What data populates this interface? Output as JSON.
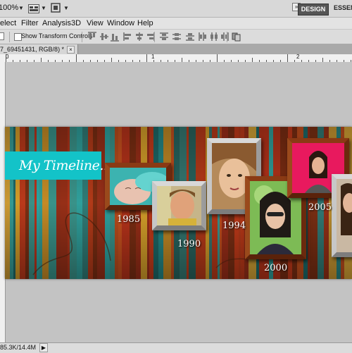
{
  "appbar": {
    "zoom": "100%",
    "workspace_active": "DESIGN",
    "workspace_next": "ESSEN"
  },
  "menu": {
    "items": [
      "elect",
      "Filter",
      "Analysis",
      "3D",
      "View",
      "Window",
      "Help"
    ]
  },
  "options": {
    "show_transform_controls": "Show Transform Controls",
    "show_transform_checked": false
  },
  "document": {
    "tab_title": "7_69451431, RGB/8) *"
  },
  "ruler": {
    "labels": [
      "0",
      "1",
      "2"
    ]
  },
  "artwork": {
    "title": "My Timeline......",
    "title_bg": "#13c3c8",
    "years": [
      "1985",
      "1990",
      "1994",
      "2000",
      "2005"
    ]
  },
  "status": {
    "doc_size": "85.3K/14.4M"
  }
}
